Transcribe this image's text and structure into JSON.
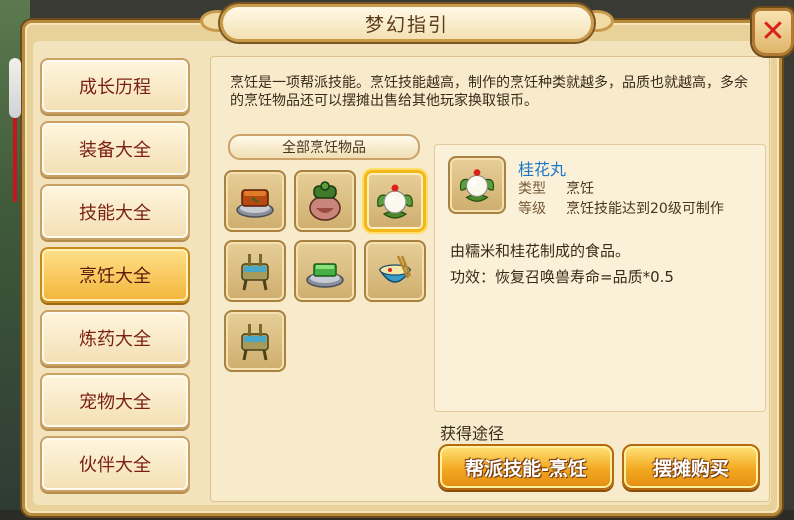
{
  "window": {
    "title": "梦幻指引",
    "close_label": "✕"
  },
  "sidebar": {
    "items": [
      {
        "label": "成长历程"
      },
      {
        "label": "装备大全"
      },
      {
        "label": "技能大全"
      },
      {
        "label": "烹饪大全",
        "active": true
      },
      {
        "label": "炼药大全"
      },
      {
        "label": "宠物大全"
      },
      {
        "label": "伙伴大全"
      }
    ]
  },
  "main": {
    "description": "烹饪是一项帮派技能。烹饪技能越高，制作的烹饪种类就越多，品质也就越高，多余的烹饪物品还可以摆摊出售给其他玩家换取银币。",
    "category_label": "全部烹饪物品",
    "items": [
      {
        "icon": "roasted-meat-icon"
      },
      {
        "icon": "jar-icon"
      },
      {
        "icon": "osmanthus-ball-icon",
        "selected": true
      },
      {
        "icon": "bronze-vessel-icon"
      },
      {
        "icon": "green-cake-icon"
      },
      {
        "icon": "noodle-bowl-icon"
      },
      {
        "icon": "bronze-vessel-icon"
      }
    ]
  },
  "detail": {
    "name": "桂花丸",
    "type_key": "类型",
    "type_val": "烹饪",
    "level_key": "等级",
    "level_val": "烹饪技能达到20级可制作",
    "flavor": "由糯米和桂花制成的食品。",
    "effect": "功效：恢复召唤兽寿命=品质*0.5"
  },
  "obtain": {
    "label": "获得途径",
    "buttons": [
      {
        "label": "帮派技能-烹饪"
      },
      {
        "label": "摆摊购买"
      }
    ]
  },
  "colors": {
    "accent": "#f3b53a",
    "item_name": "#1a78c8",
    "close": "#d6221b"
  }
}
